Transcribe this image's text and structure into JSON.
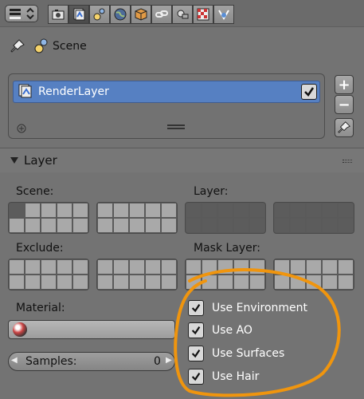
{
  "header": {
    "editor_type_icon": "properties-editor-icon",
    "context_tabs": [
      {
        "name": "render",
        "icon": "camera-icon",
        "active": false
      },
      {
        "name": "render-layers",
        "icon": "render-layers-icon",
        "active": true
      },
      {
        "name": "scene",
        "icon": "scene-icon",
        "active": false
      },
      {
        "name": "world",
        "icon": "world-icon",
        "active": false
      },
      {
        "name": "object",
        "icon": "cube-icon",
        "active": false
      },
      {
        "name": "constraints",
        "icon": "chain-icon",
        "active": false
      },
      {
        "name": "modifiers",
        "icon": "modifier-icon",
        "active": false
      },
      {
        "name": "texture",
        "icon": "checker-icon",
        "active": false
      },
      {
        "name": "physics",
        "icon": "physics-icon",
        "active": false
      }
    ]
  },
  "path": {
    "scene_label": "Scene"
  },
  "layers_list": {
    "items": [
      {
        "label": "RenderLayer",
        "enabled": true
      }
    ],
    "add_label": "+",
    "remove_label": "−"
  },
  "panel": {
    "title": "Layer",
    "scene_label": "Scene:",
    "layer_label": "Layer:",
    "exclude_label": "Exclude:",
    "mask_layer_label": "Mask Layer:",
    "material_label": "Material:",
    "samples_label": "Samples:",
    "samples_value": "0"
  },
  "checkboxes": [
    {
      "label": "Use Environment",
      "checked": true
    },
    {
      "label": "Use AO",
      "checked": true
    },
    {
      "label": "Use Surfaces",
      "checked": true
    },
    {
      "label": "Use Hair",
      "checked": true
    }
  ],
  "colors": {
    "selection": "#5680c2",
    "annotation": "#f0950e",
    "background": "#737373"
  }
}
